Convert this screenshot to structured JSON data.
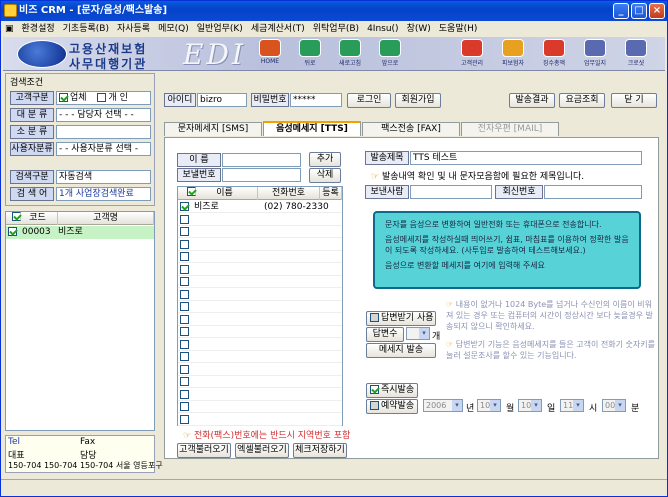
{
  "window": {
    "title": "비즈 CRM - [문자/음성/팩스발송]"
  },
  "menu": [
    "환경설정",
    "기초등록(B)",
    "자사등록",
    "메모(Q)",
    "일반업무(K)",
    "세금계산서(T)",
    "위탁업무(B)",
    "4Insu()",
    "창(W)",
    "도움말(H)"
  ],
  "banner": {
    "brand_line1": "고용산재보험",
    "brand_line2": "사무대행기관",
    "edi": "EDI"
  },
  "toolbar_left": [
    {
      "label": "HOME",
      "icon": "home-icon",
      "color": "#d9531e"
    },
    {
      "label": "뒤로",
      "icon": "back-arrow-icon",
      "color": "#2a9c5a"
    },
    {
      "label": "새로고침",
      "icon": "refresh-icon",
      "color": "#2a9c5a"
    },
    {
      "label": "앞으로",
      "icon": "forward-arrow-icon",
      "color": "#2a9c5a"
    }
  ],
  "toolbar_right": [
    {
      "label": "고객관리",
      "icon": "customer-icon",
      "color": "#d93a2a"
    },
    {
      "label": "피보험자",
      "icon": "insured-icon",
      "color": "#e8a020"
    },
    {
      "label": "징수총액",
      "icon": "collection-icon",
      "color": "#d93a2a"
    },
    {
      "label": "업무일지",
      "icon": "journal-icon",
      "color": "#5a6ab0"
    },
    {
      "label": "크로샷",
      "icon": "crossshot-icon",
      "color": "#5a6ab0"
    }
  ],
  "search": {
    "section_title": "검색조건",
    "customer_type_label": "고객구분",
    "opt_business": "업체",
    "opt_personal": "개 인",
    "large_class_label": "대 분 류",
    "manager_select": "- - - 담당자 선택 - -",
    "small_class_label": "소 분 류",
    "user_class_label": "사용자분류",
    "user_select": "- - 사용자분류 선택 -",
    "search_type_label": "검색구분",
    "search_type_value": "자동검색",
    "search_word_label": "검 색 어",
    "search_word_value": "1개 사업장검색완료"
  },
  "customer_grid": {
    "col_code": "코드",
    "col_name": "고객명",
    "rows": [
      {
        "code": "00003",
        "name": "비즈로"
      }
    ]
  },
  "contact": {
    "tel_label": "Tel",
    "fax_label": "Fax",
    "rep_label": "대표",
    "manager_label": "담당",
    "address": "150-704 150-704 150-704 서울 영등포구"
  },
  "login": {
    "id_label": "아이디",
    "id_value": "bizro",
    "pw_label": "비밀번호",
    "pw_value": "*****",
    "login_btn": "로그인",
    "join_btn": "회원가입"
  },
  "top_buttons": {
    "result": "발송결과",
    "fee": "요금조회",
    "close": "닫 기"
  },
  "tabs": [
    "문자메세지 [SMS]",
    "음성메세지 [TTS]",
    "팩스전송 [FAX]",
    "전자우편 [MAIL]"
  ],
  "recipient": {
    "name_label": "이 름",
    "number_label": "보낼번호",
    "add_btn": "추가",
    "delete_btn": "삭제",
    "col_name": "이름",
    "col_phone": "전화번호",
    "col_reg": "등록",
    "rows": [
      {
        "name": "비즈로",
        "phone": "(02) 780-2330"
      }
    ],
    "warning": "전화(팩스)번호에는 반드시 지역번호 포함",
    "btn_load_customer": "고객불러오기",
    "btn_load_excel": "엑셀불러오기",
    "btn_save_check": "체크저장하기"
  },
  "message": {
    "subject_label": "발송제목",
    "subject_value": "TTS 테스트",
    "subject_hint": "발송내역 확인 및 내 문자모음함에 필요한 제목입니다.",
    "sender_label": "보낸사람",
    "reply_label": "회신번호",
    "info_line1": "문자를 음성으로 변환하여 일반전화 또는 휴대폰으로 전송합니다.",
    "info_line2": "음성메세지를 작성하실때 띄어쓰기, 쉼표, 마침표를 이용하여 정확한 발음이 되도록 작성하세요. (사투입로 발송하여 테스트해보세요.)",
    "info_line3": "음성으로 변환할 메세지를 여기에 입력해 주세요"
  },
  "options": {
    "reply_use": "답변받기 사용",
    "reply_count_label": "답변수",
    "reply_count_unit": "개",
    "send_btn": "메세지 발송",
    "note1": "내용이 없거나 1024 Byte를 넘거나 수신인의 이름이 비워져 있는 경우 또는 컴퓨터의 시간이 정상시간 보다 늦을경우 발송되지 않으니 확인하세요.",
    "note2": "답변받기 기능은 음성메세지를 들은 고객이 전화기 숫자키를 눌러 설문조사를 할수 있는 기능입니다.",
    "instant": "즉시발송",
    "reserve": "예약발송",
    "year": "2006",
    "year_unit": "년",
    "month": "10",
    "month_unit": "월",
    "day": "10",
    "day_unit": "일",
    "hour": "11",
    "hour_unit": "시",
    "minute": "00",
    "minute_unit": "분"
  }
}
